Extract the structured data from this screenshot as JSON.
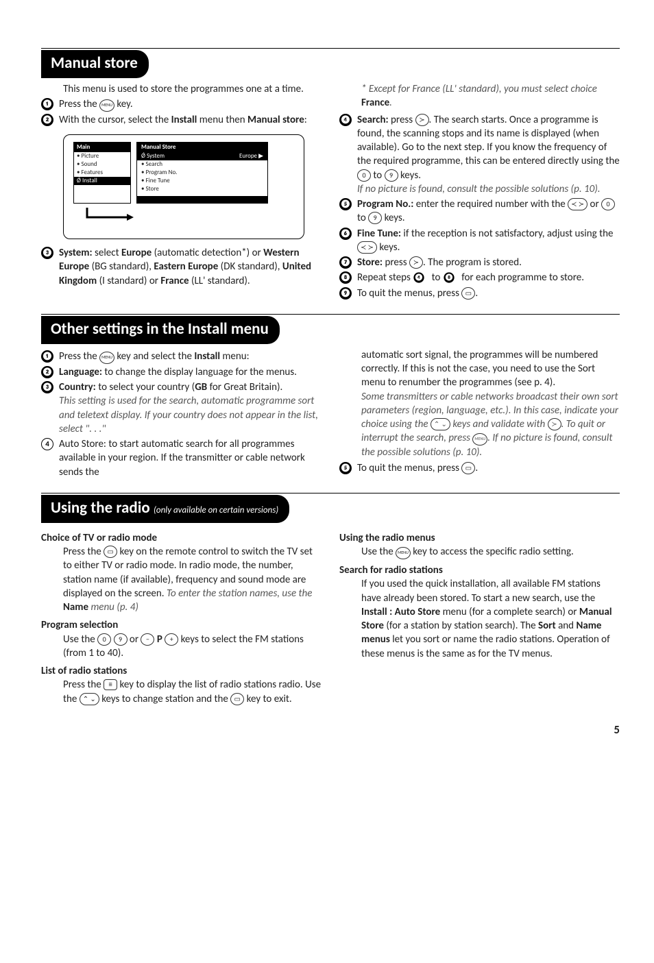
{
  "section1": {
    "title": "Manual store",
    "intro": "This menu is used to store the programmes one at a time.",
    "step1": "Press the",
    "step1b": "key.",
    "step2a": "With the cursor, select the ",
    "step2b": "Install",
    "step2c": " menu then ",
    "step2d": "Manual store",
    "step2e": ":",
    "menu": {
      "leftTitle": "Main",
      "leftItems": [
        "• Picture",
        "• Sound",
        "• Features",
        "Ǿ Install"
      ],
      "rightTitle": "Manual Store",
      "row1l": "Ǿ System",
      "row1r": "Europe ▶",
      "rows": [
        "• Search",
        "• Program No.",
        "• Fine Tune",
        "• Store"
      ]
    },
    "step3a": "System:",
    "step3b": " select ",
    "step3c": "Europe",
    "step3d": " (automatic detection*) or ",
    "step3e": "Western Europe",
    "step3f": " (BG standard), ",
    "step3g": "Eastern Europe",
    "step3h": " (DK standard), ",
    "step3i": "United Kingdom",
    "step3j": " (I standard) or ",
    "step3k": "France",
    "step3l": " (LL' standard).",
    "noteStar": "* Except for France (LL' standard), you must select choice ",
    "noteStarBold": "France",
    "noteStarEnd": ".",
    "step4a": "Search:",
    "step4b": " press ",
    "step4c": ". The search starts. Once a programme is found, the scanning stops and its name is displayed (when available). Go to the next step. If you know the frequency of the required programme, this can be entered directly using the ",
    "step4d": " to ",
    "step4e": " keys.",
    "step4note": "If no picture is found, consult the possible solutions (p. 10).",
    "step5a": "Program No.:",
    "step5b": " enter the required number with the ",
    "step5c": " or ",
    "step5d": " to ",
    "step5e": " keys.",
    "step6a": "Fine Tune:",
    "step6b": " if the reception is not satisfactory, adjust using the ",
    "step6c": " keys.",
    "step7a": "Store:",
    "step7b": " press ",
    "step7c": ". The program is stored.",
    "step8a": "Repeat steps ",
    "step8b": " to ",
    "step8c": " for each programme to store.",
    "step9a": "To quit the menus, press ",
    "step9b": "."
  },
  "section2": {
    "title": "Other settings in the Install menu",
    "step1a": "Press the ",
    "step1b": " key and select the ",
    "step1c": "Install",
    "step1d": " menu:",
    "step2a": "Language:",
    "step2b": " to change the display language for the menus.",
    "step3a": "Country:",
    "step3b": " to select your country (",
    "step3c": "GB",
    "step3d": " for Great Britain).",
    "step3note": "This setting is used for the search, automatic programme sort and teletext display. If your country does not appear in the list, select \". . .\"",
    "step4a": "Auto Store: to start automatic search for all programmes available in your region. If the transmitter or cable network sends the",
    "rightPara": "automatic sort signal, the programmes will be numbered correctly. If this is not the case, you need to use the Sort menu to renumber the programmes (see p. 4).",
    "rightNote1": "Some transmitters or cable networks broadcast their own sort parameters (region, language, etc.). In this case, indicate your choice using the ",
    "rightNote2": " keys and validate with ",
    "rightNote3": ". To quit or interrupt the search, press ",
    "rightNote4": ". If no picture is found, consult the possible solutions (p. 10).",
    "step5a": "To quit the menus, press ",
    "step5b": "."
  },
  "section3": {
    "title": "Using the radio",
    "subtitle": "(only available on certain versions)",
    "h1": "Choice of TV or radio mode",
    "p1a": "Press the ",
    "p1b": " key on the remote control to switch the TV set to either TV or radio mode. In radio mode, the number, station name (if available), frequency and sound mode are displayed on the screen. ",
    "p1note": "To enter the station names, use the ",
    "p1bold": "Name",
    "p1end": " menu (p. 4)",
    "h2": "Program selection",
    "p2a": "Use the ",
    "p2b": " or ",
    "p2c": " P ",
    "p2d": " keys to select the FM stations (from 1 to 40).",
    "h3": "List of radio stations",
    "p3a": "Press the ",
    "p3b": " key to display the list of radio stations radio. Use the ",
    "p3c": " keys to change station and the ",
    "p3d": " key to exit.",
    "h4": "Using the radio menus",
    "p4a": "Use the ",
    "p4b": " key to access the specific radio setting.",
    "h5": "Search for radio stations",
    "p5a": "If you used the quick installation, all available FM stations have already been stored. To start a new search, use the ",
    "p5b": "Install : Auto Store",
    "p5c": " menu (for a complete search) or ",
    "p5d": "Manual Store",
    "p5e": " (for a station by station search). The ",
    "p5f": "Sort",
    "p5g": " and ",
    "p5h": "Name menus",
    "p5i": " let you sort or name the radio stations. Operation of these menus is the same as for the TV menus."
  },
  "pageNum": "5",
  "keys": {
    "menu": "MENU",
    "k0": "0",
    "k9": "9",
    "right": "≻",
    "leftright": "≺ ≻",
    "updown": "⌃ ⌄",
    "exit": "▭",
    "list": "≡",
    "minus": "−",
    "plus": "+",
    "tv": "▭"
  }
}
